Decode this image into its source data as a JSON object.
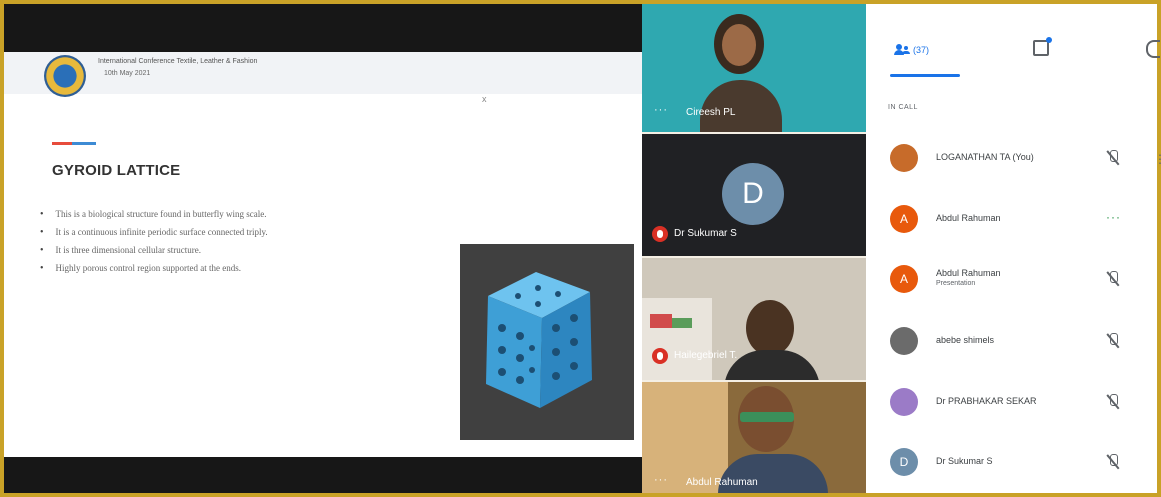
{
  "slide": {
    "conference_line1": "International Conference Textile, Leather & Fashion",
    "conference_line2": "10th May 2021",
    "mark": "x",
    "title": "GYROID LATTICE",
    "bullets": [
      "This is a biological structure found in butterfly wing scale.",
      "It is a continuous infinite periodic surface connected triply.",
      "It is three dimensional cellular structure.",
      "Highly porous control region supported at the ends."
    ],
    "image_color": "#4fa8d8"
  },
  "video_tiles": [
    {
      "label": "Cireesh PL",
      "more": "···"
    },
    {
      "label": "Dr Sukumar S",
      "avatar_letter": "D"
    },
    {
      "label": "Hailegebriel T.",
      "more": ""
    },
    {
      "label": "Abdul Rahuman",
      "more": "···"
    }
  ],
  "panel": {
    "people_count": "(37)",
    "section_label": "IN CALL",
    "accent_color": "#1a73e8",
    "participants": [
      {
        "name": "LOGANATHAN TA (You)",
        "sub": "",
        "avatar": "",
        "avatar_color": "#c76b2a",
        "state": "muted"
      },
      {
        "name": "Abdul Rahuman",
        "sub": "",
        "avatar": "A",
        "avatar_color": "#e8590c",
        "state": "more"
      },
      {
        "name": "Abdul Rahuman",
        "sub": "Presentation",
        "avatar": "A",
        "avatar_color": "#e8590c",
        "state": "muted"
      },
      {
        "name": "abebe shimels",
        "sub": "",
        "avatar": "",
        "avatar_color": "#6b6b6b",
        "state": "muted"
      },
      {
        "name": "Dr PRABHAKAR SEKAR",
        "sub": "",
        "avatar": "",
        "avatar_color": "#9b7bc7",
        "state": "muted"
      },
      {
        "name": "Dr Sukumar S",
        "sub": "",
        "avatar": "D",
        "avatar_color": "#6d8eaa",
        "state": "muted"
      }
    ]
  }
}
